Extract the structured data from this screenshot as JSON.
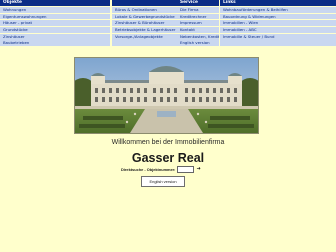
{
  "nav": {
    "columns": [
      {
        "heading": "Objekte",
        "items": [
          "Wohnungen",
          "Eigentumswohnungen",
          "Häuser - privat",
          "Grundstücke",
          "Zinshäuser",
          "Baubetrieben"
        ]
      },
      {
        "heading": "",
        "items": [
          "Büros & Ordinationen",
          "Lokale & Gewerbegrundstücke",
          "Zinshäuser & Bürohäuser",
          "Betriebsobjekte & Lagerhäuser",
          "Vorsorge-/Anlageobjekte",
          ""
        ]
      },
      {
        "heading": "Service",
        "items": [
          "Die Firma",
          "Kreditrechner",
          "Impressum",
          "Kontakt",
          "Nebenkosten, Kreditrechner, AGB",
          "English version"
        ]
      },
      {
        "heading": "Links",
        "items": [
          "Wohnbauförderungen & Beihilfen",
          "Bauordnung & Widmungen",
          "Immobilien - Wien",
          "Immobilien - ABC",
          "Immobilie & Steuer / Bund",
          ""
        ]
      }
    ]
  },
  "hero": {
    "image_desc": "palace-photo"
  },
  "welcome_text": "Willkommen bei der Immobilienfirma",
  "company_name": "Gasser Real",
  "search": {
    "label": "Direktsuche - Objektnummer:",
    "value": "",
    "go_icon": "arrow-right-icon"
  },
  "english_button": "English version",
  "colors": {
    "nav_header_bg": "#0A2C86",
    "nav_item_bg": "#C9D7F0",
    "page_bg": "#FFFFCC"
  }
}
